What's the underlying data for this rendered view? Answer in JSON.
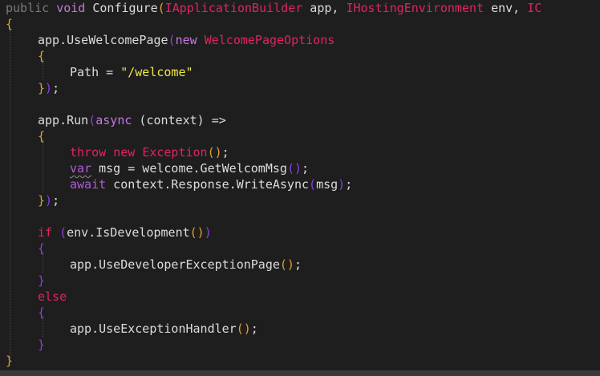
{
  "code": {
    "l1": {
      "kw_public": "public",
      "sp1": " ",
      "kw_void": "void",
      "sp2": " ",
      "name": "Configure",
      "p1": "(",
      "type1": "IApplicationBuilder",
      "arg1": " app, ",
      "type2": "IHostingEnvironment",
      "arg2": " env, ",
      "type3": "IC"
    },
    "l2": {
      "brace": "{"
    },
    "l3": {
      "call": "app.UseWelcomePage",
      "p": "(",
      "kw_new": "new",
      "sp": " ",
      "type": "WelcomePageOptions"
    },
    "l4": {
      "brace": "{"
    },
    "l5": {
      "prop": "Path = ",
      "str": "\"/welcome\""
    },
    "l6": {
      "brace": "}",
      "p": ")",
      "semi": ";"
    },
    "l7": {
      "call": "app.Run",
      "p": "(",
      "kw_async": "async",
      "mid": " (context) =>"
    },
    "l8": {
      "brace": "{"
    },
    "l9": {
      "kw_throw": "throw",
      "sp1": " ",
      "kw_new": "new",
      "sp2": " ",
      "type": "Exception",
      "paren": "()",
      "semi": ";"
    },
    "l10": {
      "kw_var": "var",
      "mid": " msg = welcome.GetWelcomMsg",
      "paren": "()",
      "semi": ";"
    },
    "l11": {
      "kw_await": "await",
      "mid": " context.Response.WriteAsync",
      "p1": "(",
      "arg": "msg",
      "p2": ")",
      "semi": ";"
    },
    "l12": {
      "brace": "}",
      "p": ")",
      "semi": ";"
    },
    "l13": {
      "kw_if": "if",
      "sp": " ",
      "p1": "(",
      "mid": "env.IsDevelopment",
      "paren": "()",
      "p2": ")"
    },
    "l14": {
      "brace": "{"
    },
    "l15": {
      "call": "app.UseDeveloperExceptionPage",
      "paren": "()",
      "semi": ";"
    },
    "l16": {
      "brace": "}"
    },
    "l17": {
      "kw_else": "else"
    },
    "l18": {
      "brace": "{"
    },
    "l19": {
      "call": "app.UseExceptionHandler",
      "paren": "()",
      "semi": ";"
    },
    "l20": {
      "brace": "}"
    },
    "l21": {
      "brace": "}"
    }
  }
}
